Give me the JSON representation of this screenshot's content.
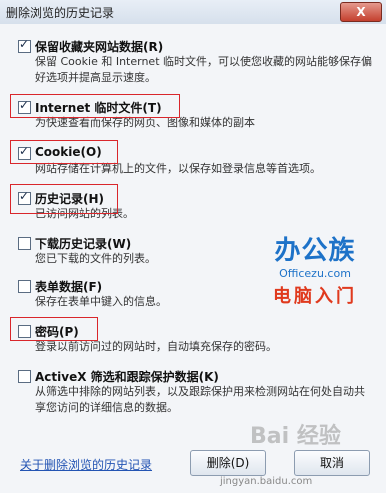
{
  "window": {
    "title": "删除浏览的历史记录",
    "close_label": "X"
  },
  "options": [
    {
      "title": "保留收藏夹网站数据(R)",
      "checked": true,
      "desc": "保留 Cookie 和 Internet 临时文件，可以使您收藏的网站能够保存偏好选项并提高显示速度。"
    },
    {
      "title": "Internet 临时文件(T)",
      "checked": true,
      "desc": "为快速查看而保存的网页、图像和媒体的副本"
    },
    {
      "title": "Cookie(O)",
      "checked": true,
      "desc": "网站存储在计算机上的文件，以保存如登录信息等首选项。"
    },
    {
      "title": "历史记录(H)",
      "checked": true,
      "desc": "已访问网站的列表。"
    },
    {
      "title": "下载历史记录(W)",
      "checked": false,
      "desc": "您已下载的文件的列表。"
    },
    {
      "title": "表单数据(F)",
      "checked": false,
      "desc": "保存在表单中键入的信息。"
    },
    {
      "title": "密码(P)",
      "checked": false,
      "desc": "登录以前访问过的网站时，自动填充保存的密码。"
    },
    {
      "title": "ActiveX 筛选和跟踪保护数据(K)",
      "checked": false,
      "desc": "从筛选中排除的网站列表，以及跟踪保护用来检测网站在何处自动共享您访问的详细信息的数据。"
    }
  ],
  "watermark": {
    "brand": "办公族",
    "url": "Officezu.com",
    "subtitle": "电脑入门",
    "baidu": "Bai 经验"
  },
  "footer": {
    "link": "关于删除浏览的历史记录",
    "delete_label": "删除(D)",
    "cancel_label": "取消",
    "bottom_note": "jingyan.baidu.com"
  }
}
